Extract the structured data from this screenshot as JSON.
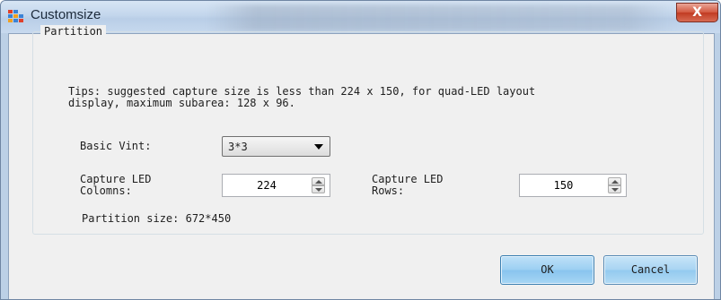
{
  "window": {
    "title": "Customsize",
    "close_glyph": "X",
    "icon": "app-grid-icon"
  },
  "partition": {
    "legend": "Partition",
    "tips_line1": "Tips: suggested capture size is less than 224 x 150, for quad-LED layout",
    "tips_line2": "display, maximum subarea: 128 x 96.",
    "basic_unit_label": "Basic Vint:",
    "basic_unit_value": "3*3",
    "columns_label_line1": "Capture LED",
    "columns_label_line2": "Colomns:",
    "columns_value": "224",
    "rows_label_line1": "Capture LED",
    "rows_label_line2": "Rows:",
    "rows_value": "150",
    "partition_size": "Partition size: 672*450"
  },
  "buttons": {
    "ok_label": "OK",
    "cancel_label": "Cancel"
  },
  "colors": {
    "titlebar": "#c3d6ec",
    "client": "#f0f0f0",
    "close_button": "#c13b22",
    "ok_button": "#9bcff2"
  }
}
